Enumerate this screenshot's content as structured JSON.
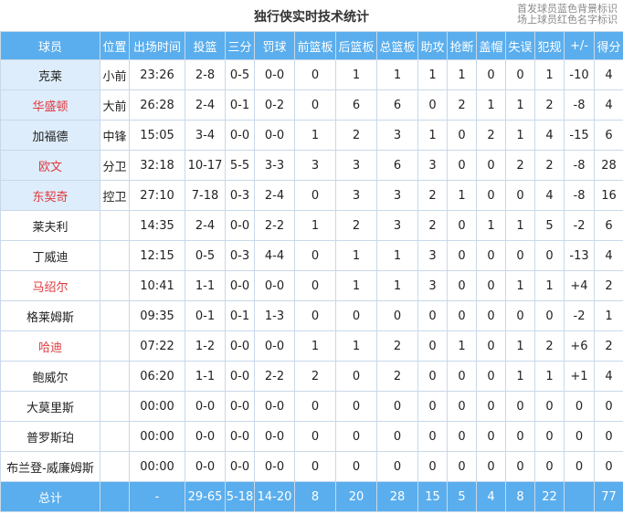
{
  "header": {
    "title": "独行侠实时技术统计",
    "legend_line1": "首发球员蓝色背景标识",
    "legend_line2": "场上球员红色名字标识"
  },
  "columns": [
    "球员",
    "位置",
    "出场时间",
    "投篮",
    "三分",
    "罚球",
    "前篮板",
    "后篮板",
    "总篮板",
    "助攻",
    "抢断",
    "盖帽",
    "失误",
    "犯规",
    "+/-",
    "得分"
  ],
  "players": [
    {
      "name": "克莱",
      "pos": "小前",
      "min": "23:26",
      "fg": "2-8",
      "tp": "0-5",
      "ft": "0-0",
      "oreb": "0",
      "dreb": "1",
      "reb": "1",
      "ast": "1",
      "stl": "1",
      "blk": "0",
      "tov": "0",
      "pf": "1",
      "pm": "-10",
      "pts": "4",
      "starter": true,
      "on_court": false
    },
    {
      "name": "华盛顿",
      "pos": "大前",
      "min": "26:28",
      "fg": "2-4",
      "tp": "0-1",
      "ft": "0-2",
      "oreb": "0",
      "dreb": "6",
      "reb": "6",
      "ast": "0",
      "stl": "2",
      "blk": "1",
      "tov": "1",
      "pf": "2",
      "pm": "-8",
      "pts": "4",
      "starter": true,
      "on_court": true
    },
    {
      "name": "加福德",
      "pos": "中锋",
      "min": "15:05",
      "fg": "3-4",
      "tp": "0-0",
      "ft": "0-0",
      "oreb": "1",
      "dreb": "2",
      "reb": "3",
      "ast": "1",
      "stl": "0",
      "blk": "2",
      "tov": "1",
      "pf": "4",
      "pm": "-15",
      "pts": "6",
      "starter": true,
      "on_court": false
    },
    {
      "name": "欧文",
      "pos": "分卫",
      "min": "32:18",
      "fg": "10-17",
      "tp": "5-5",
      "ft": "3-3",
      "oreb": "3",
      "dreb": "3",
      "reb": "6",
      "ast": "3",
      "stl": "0",
      "blk": "0",
      "tov": "2",
      "pf": "2",
      "pm": "-8",
      "pts": "28",
      "starter": true,
      "on_court": true
    },
    {
      "name": "东契奇",
      "pos": "控卫",
      "min": "27:10",
      "fg": "7-18",
      "tp": "0-3",
      "ft": "2-4",
      "oreb": "0",
      "dreb": "3",
      "reb": "3",
      "ast": "2",
      "stl": "1",
      "blk": "0",
      "tov": "0",
      "pf": "4",
      "pm": "-8",
      "pts": "16",
      "starter": true,
      "on_court": true
    },
    {
      "name": "莱夫利",
      "pos": "",
      "min": "14:35",
      "fg": "2-4",
      "tp": "0-0",
      "ft": "2-2",
      "oreb": "1",
      "dreb": "2",
      "reb": "3",
      "ast": "2",
      "stl": "0",
      "blk": "1",
      "tov": "1",
      "pf": "5",
      "pm": "-2",
      "pts": "6",
      "starter": false,
      "on_court": false
    },
    {
      "name": "丁威迪",
      "pos": "",
      "min": "12:15",
      "fg": "0-5",
      "tp": "0-3",
      "ft": "4-4",
      "oreb": "0",
      "dreb": "1",
      "reb": "1",
      "ast": "3",
      "stl": "0",
      "blk": "0",
      "tov": "0",
      "pf": "0",
      "pm": "-13",
      "pts": "4",
      "starter": false,
      "on_court": false
    },
    {
      "name": "马绍尔",
      "pos": "",
      "min": "10:41",
      "fg": "1-1",
      "tp": "0-0",
      "ft": "0-0",
      "oreb": "0",
      "dreb": "1",
      "reb": "1",
      "ast": "3",
      "stl": "0",
      "blk": "0",
      "tov": "1",
      "pf": "1",
      "pm": "+4",
      "pts": "2",
      "starter": false,
      "on_court": true
    },
    {
      "name": "格莱姆斯",
      "pos": "",
      "min": "09:35",
      "fg": "0-1",
      "tp": "0-1",
      "ft": "1-3",
      "oreb": "0",
      "dreb": "0",
      "reb": "0",
      "ast": "0",
      "stl": "0",
      "blk": "0",
      "tov": "0",
      "pf": "0",
      "pm": "-2",
      "pts": "1",
      "starter": false,
      "on_court": false
    },
    {
      "name": "哈迪",
      "pos": "",
      "min": "07:22",
      "fg": "1-2",
      "tp": "0-0",
      "ft": "0-0",
      "oreb": "1",
      "dreb": "1",
      "reb": "2",
      "ast": "0",
      "stl": "1",
      "blk": "0",
      "tov": "1",
      "pf": "2",
      "pm": "+6",
      "pts": "2",
      "starter": false,
      "on_court": true
    },
    {
      "name": "鲍威尔",
      "pos": "",
      "min": "06:20",
      "fg": "1-1",
      "tp": "0-0",
      "ft": "2-2",
      "oreb": "2",
      "dreb": "0",
      "reb": "2",
      "ast": "0",
      "stl": "0",
      "blk": "0",
      "tov": "1",
      "pf": "1",
      "pm": "+1",
      "pts": "4",
      "starter": false,
      "on_court": false
    },
    {
      "name": "大莫里斯",
      "pos": "",
      "min": "00:00",
      "fg": "0-0",
      "tp": "0-0",
      "ft": "0-0",
      "oreb": "0",
      "dreb": "0",
      "reb": "0",
      "ast": "0",
      "stl": "0",
      "blk": "0",
      "tov": "0",
      "pf": "0",
      "pm": "0",
      "pts": "0",
      "starter": false,
      "on_court": false
    },
    {
      "name": "普罗斯珀",
      "pos": "",
      "min": "00:00",
      "fg": "0-0",
      "tp": "0-0",
      "ft": "0-0",
      "oreb": "0",
      "dreb": "0",
      "reb": "0",
      "ast": "0",
      "stl": "0",
      "blk": "0",
      "tov": "0",
      "pf": "0",
      "pm": "0",
      "pts": "0",
      "starter": false,
      "on_court": false
    },
    {
      "name": "布兰登-威廉姆斯",
      "pos": "",
      "min": "00:00",
      "fg": "0-0",
      "tp": "0-0",
      "ft": "0-0",
      "oreb": "0",
      "dreb": "0",
      "reb": "0",
      "ast": "0",
      "stl": "0",
      "blk": "0",
      "tov": "0",
      "pf": "0",
      "pm": "0",
      "pts": "0",
      "starter": false,
      "on_court": false
    }
  ],
  "totals": {
    "label": "总计",
    "min": "-",
    "fg": "29-65",
    "tp": "5-18",
    "ft": "14-20",
    "oreb": "8",
    "dreb": "20",
    "reb": "28",
    "ast": "15",
    "stl": "5",
    "blk": "4",
    "tov": "8",
    "pf": "22",
    "pm": "",
    "pts": "77"
  },
  "colors": {
    "header_bg": "#5aaeee",
    "starter_bg": "#deedfb",
    "on_court_text": "#e0393e",
    "border": "#c8d9ea"
  }
}
